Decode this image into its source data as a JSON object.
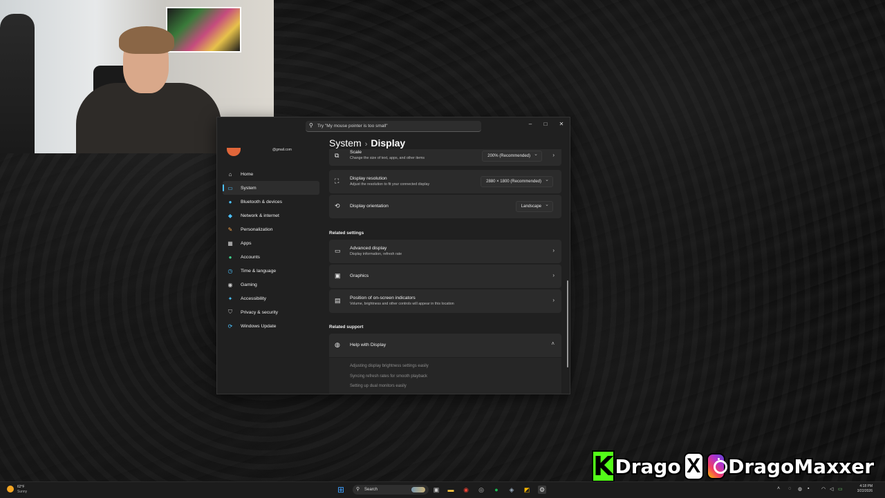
{
  "window": {
    "search_placeholder": "Try \"My mouse pointer is too small\"",
    "user_email_fragment": "@gmail.com",
    "breadcrumb": {
      "parent": "System",
      "separator": "›",
      "current": "Display"
    }
  },
  "nav": {
    "items": [
      {
        "label": "Home",
        "icon": "home-icon",
        "color": "#e0e0e0",
        "active": false
      },
      {
        "label": "System",
        "icon": "system-icon",
        "color": "#4cc2ff",
        "active": true
      },
      {
        "label": "Bluetooth & devices",
        "icon": "bluetooth-icon",
        "color": "#4cc2ff",
        "active": false
      },
      {
        "label": "Network & internet",
        "icon": "network-icon",
        "color": "#4cc2ff",
        "active": false
      },
      {
        "label": "Personalization",
        "icon": "personalization-icon",
        "color": "#f7a44a",
        "active": false
      },
      {
        "label": "Apps",
        "icon": "apps-icon",
        "color": "#cfcfcf",
        "active": false
      },
      {
        "label": "Accounts",
        "icon": "accounts-icon",
        "color": "#3fd08a",
        "active": false
      },
      {
        "label": "Time & language",
        "icon": "time-language-icon",
        "color": "#4cc2ff",
        "active": false
      },
      {
        "label": "Gaming",
        "icon": "gaming-icon",
        "color": "#cfcfcf",
        "active": false
      },
      {
        "label": "Accessibility",
        "icon": "accessibility-icon",
        "color": "#4cc2ff",
        "active": false
      },
      {
        "label": "Privacy & security",
        "icon": "shield-icon",
        "color": "#bdbdbd",
        "active": false
      },
      {
        "label": "Windows Update",
        "icon": "windows-update-icon",
        "color": "#4cc2ff",
        "active": false
      }
    ]
  },
  "settings": {
    "scale": {
      "title": "Scale",
      "subtitle": "Change the size of text, apps, and other items",
      "value": "200% (Recommended)"
    },
    "resolution": {
      "title": "Display resolution",
      "subtitle": "Adjust the resolution to fit your connected display",
      "value": "2880 × 1800 (Recommended)"
    },
    "orientation": {
      "title": "Display orientation",
      "value": "Landscape"
    },
    "related_settings_label": "Related settings",
    "advanced": {
      "title": "Advanced display",
      "subtitle": "Display information, refresh rate"
    },
    "graphics": {
      "title": "Graphics"
    },
    "indicators": {
      "title": "Position of on-screen indicators",
      "subtitle": "Volume, brightness and other controls will appear in this location"
    },
    "related_support_label": "Related support",
    "help": {
      "title": "Help with Display"
    },
    "help_links": [
      "Adjusting display brightness settings easily",
      "Syncing refresh rates for smooth playback",
      "Setting up dual monitors easily"
    ]
  },
  "banner": {
    "kick_letter": "K",
    "kick_name": "Drago",
    "x_letter": "X",
    "ig_name": "DragoMaxxer"
  },
  "taskbar": {
    "weather_temp": "62°F",
    "weather_condition": "Sunny",
    "search_label": "Search",
    "time": "4:18 PM",
    "date": "3/22/2026"
  },
  "colors": {
    "accent": "#4cc2ff",
    "kick_green": "#53fc18",
    "window_bg": "#202020",
    "card_bg": "#2b2b2b"
  }
}
